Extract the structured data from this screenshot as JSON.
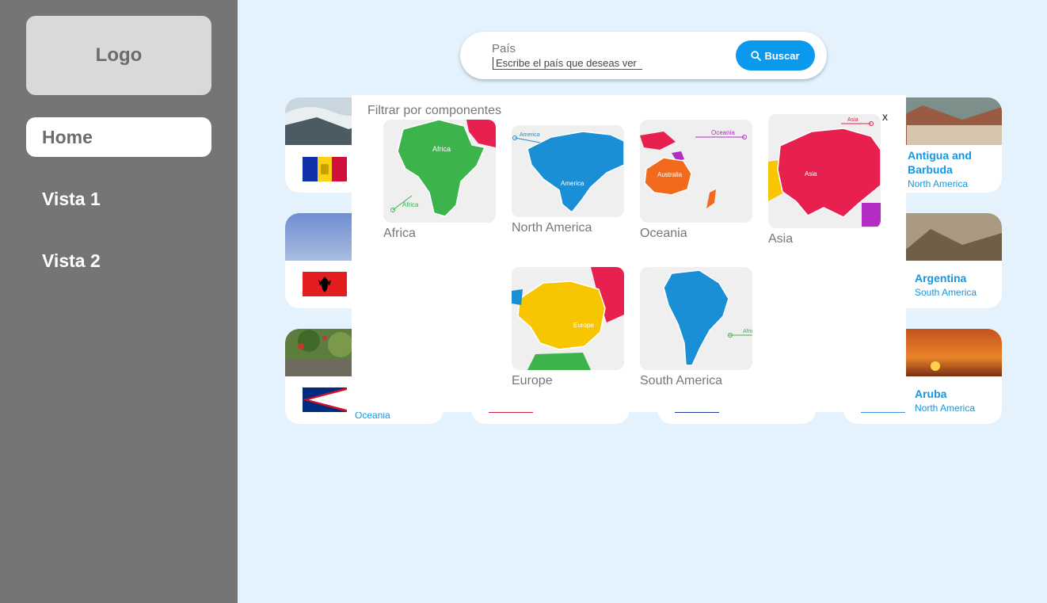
{
  "sidebar": {
    "logo": "Logo",
    "items": [
      {
        "label": "Home",
        "active": true
      },
      {
        "label": "Vista 1",
        "active": false
      },
      {
        "label": "Vista 2",
        "active": false
      }
    ]
  },
  "search": {
    "label": "País",
    "placeholder": "Escribe el país que deseas ver",
    "button": "Buscar",
    "icon": "search-icon"
  },
  "cards": [
    {
      "name": "",
      "region": "",
      "flag": "andorra-flag"
    },
    {
      "name": "Antigua and Barbuda",
      "region": "North America",
      "flag": "antigua-flag"
    },
    {
      "name": "",
      "region": "",
      "flag": "albania-flag"
    },
    {
      "name": "Argentina",
      "region": "South America",
      "flag": "argentina-flag"
    },
    {
      "name": "",
      "region": "Oceania",
      "flag": "american-samoa-flag"
    },
    {
      "name": "Aruba",
      "region": "North America",
      "flag": "aruba-flag"
    }
  ],
  "filter": {
    "title": "Filtrar por componentes",
    "close": "x",
    "regions": [
      {
        "label": "Africa",
        "map_text": "Africa",
        "color": "#3cb44b"
      },
      {
        "label": "North America",
        "map_text": "America",
        "color": "#1a8fd6"
      },
      {
        "label": "Oceania",
        "map_text": "Australia",
        "map_text2": "Oceania",
        "color": "#f26b1d"
      },
      {
        "label": "Asia",
        "map_text": "Asia",
        "color": "#e8204f"
      },
      {
        "label": "Europe",
        "map_text": "Europe",
        "color": "#f7c600"
      },
      {
        "label": "South America",
        "map_text": "",
        "color": "#1a8fd6"
      }
    ]
  }
}
